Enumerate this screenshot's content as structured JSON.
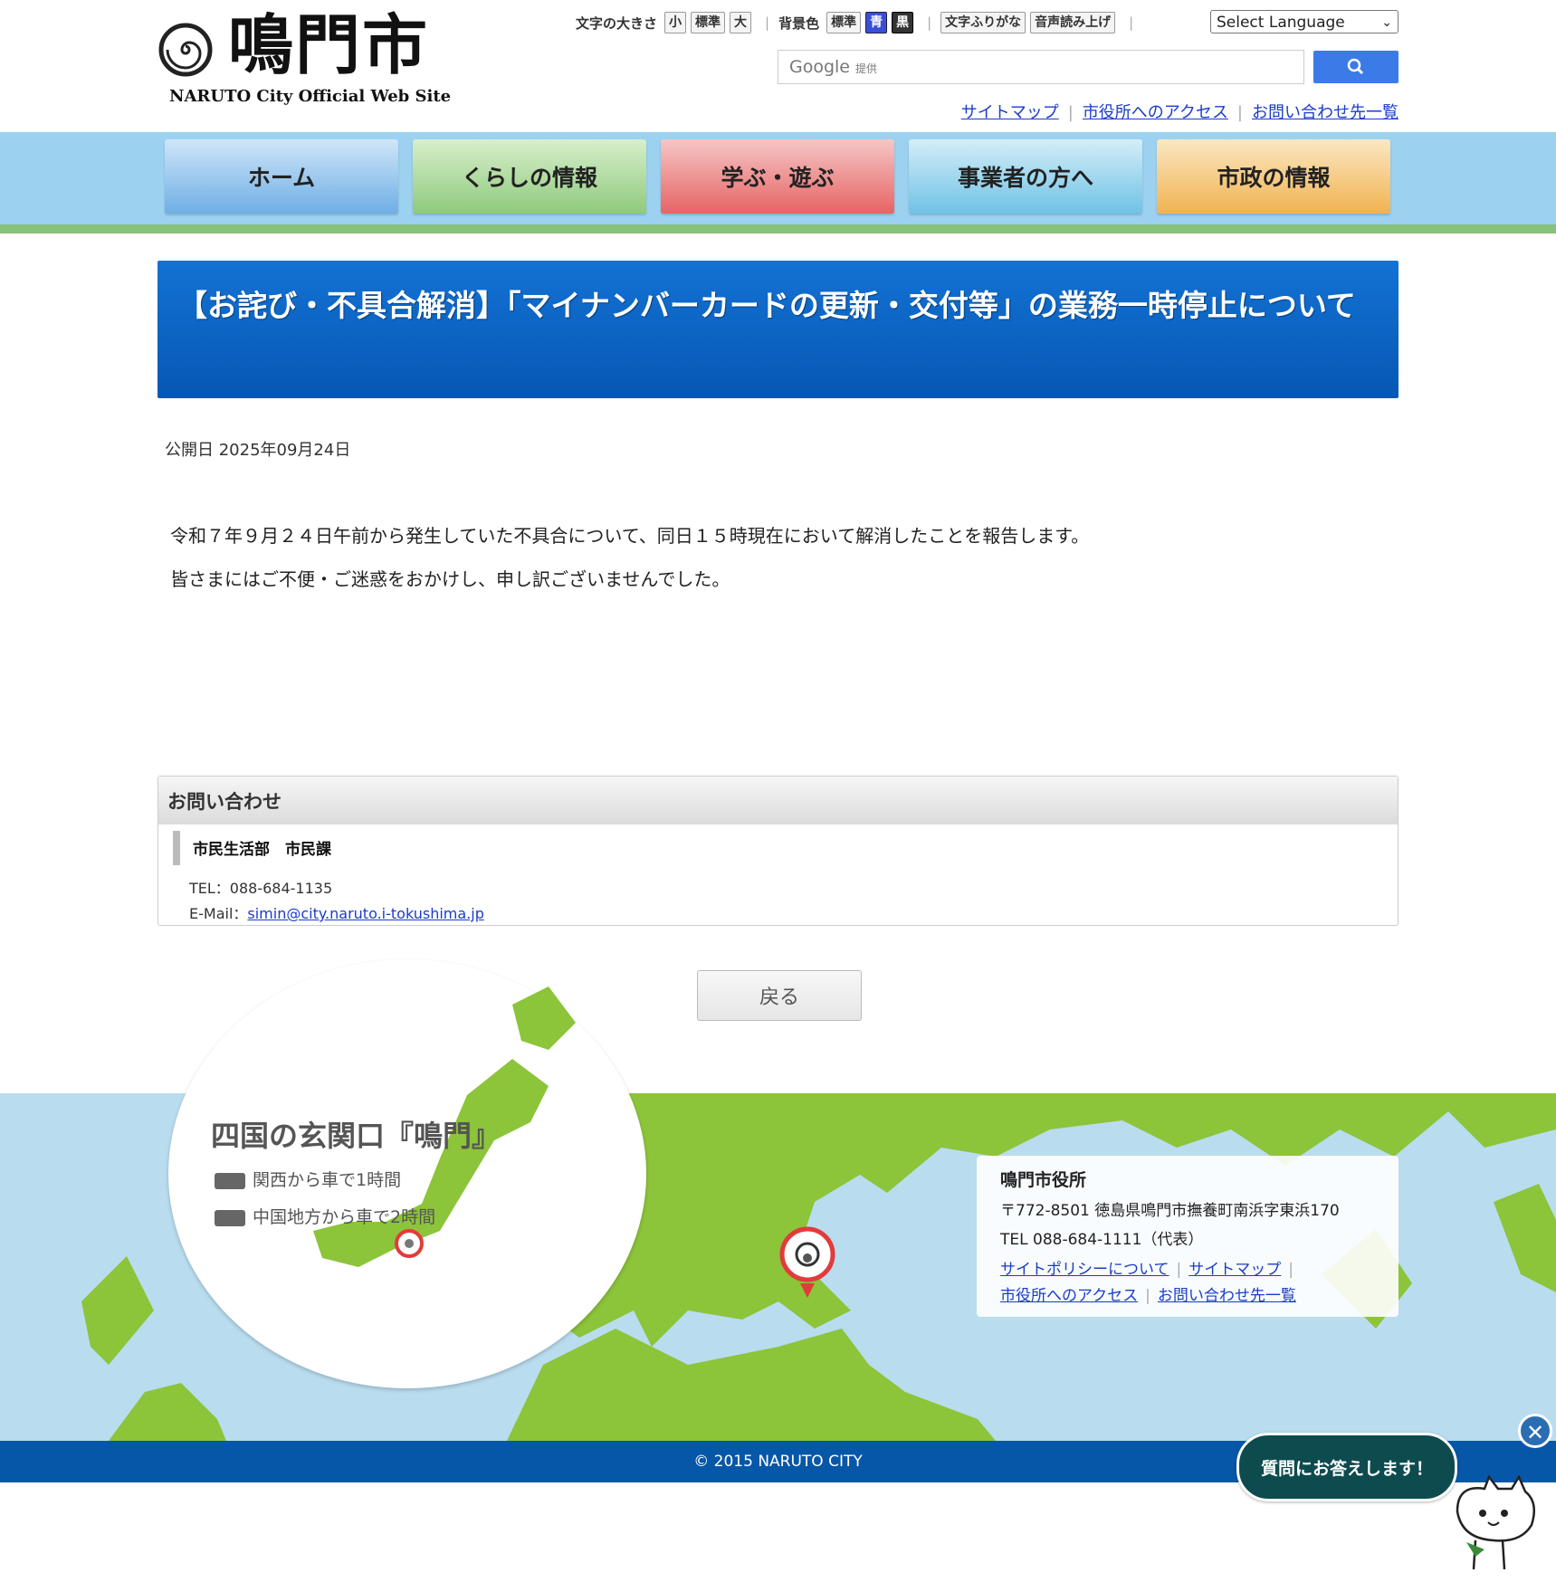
{
  "header": {
    "logo_text": "鳴門市",
    "logo_sub": "NARUTO City Official Web Site",
    "font_size_label": "文字の大きさ",
    "font_sizes": [
      "小",
      "標準",
      "大"
    ],
    "bg_label": "背景色",
    "bg_options": [
      "標準",
      "青",
      "黒"
    ],
    "furigana": "文字ふりがな",
    "read_aloud": "音声読み上げ",
    "language": "Select Language",
    "search_brand": "Google",
    "search_provided": "提供",
    "top_links": [
      "サイトマップ",
      "市役所へのアクセス",
      "お問い合わせ先一覧"
    ]
  },
  "nav": [
    "ホーム",
    "くらしの情報",
    "学ぶ・遊ぶ",
    "事業者の方へ",
    "市政の情報"
  ],
  "article": {
    "title": "【お詫び・不具合解消】「マイナンバーカードの更新・交付等」の業務一時停止について",
    "published": "公開日 2025年09月24日",
    "body": [
      "令和７年９月２４日午前から発生していた不具合について、同日１５時現在において解消したことを報告します。",
      "皆さまにはご不便・ご迷惑をおかけし、申し訳ございませんでした。"
    ]
  },
  "contact": {
    "heading": "お問い合わせ",
    "dept": "市民生活部　市民課",
    "tel": "TEL：088-684-1135",
    "mail_label": "E-Mail：",
    "mail": "simin@city.naruto.i-tokushima.jp"
  },
  "back_label": "戻る",
  "footer": {
    "circle_title": "四国の玄関口『鳴門』",
    "access1": "関西から車で1時間",
    "access2": "中国地方から車で2時間",
    "office_name": "鳴門市役所",
    "address": "〒772-8501 徳島県鳴門市撫養町南浜字東浜170",
    "tel": "TEL 088-684-1111（代表）",
    "links": [
      "サイトポリシーについて",
      "サイトマップ",
      "市役所へのアクセス",
      "お問い合わせ先一覧"
    ],
    "copyright": "© 2015 NARUTO CITY"
  },
  "chat_label": "質問にお答えします！",
  "colors": {
    "nav_bar": "#9cd1ef",
    "title_bg": "#0757b4",
    "footer_bar": "#0757a8",
    "land": "#8cc43a"
  }
}
